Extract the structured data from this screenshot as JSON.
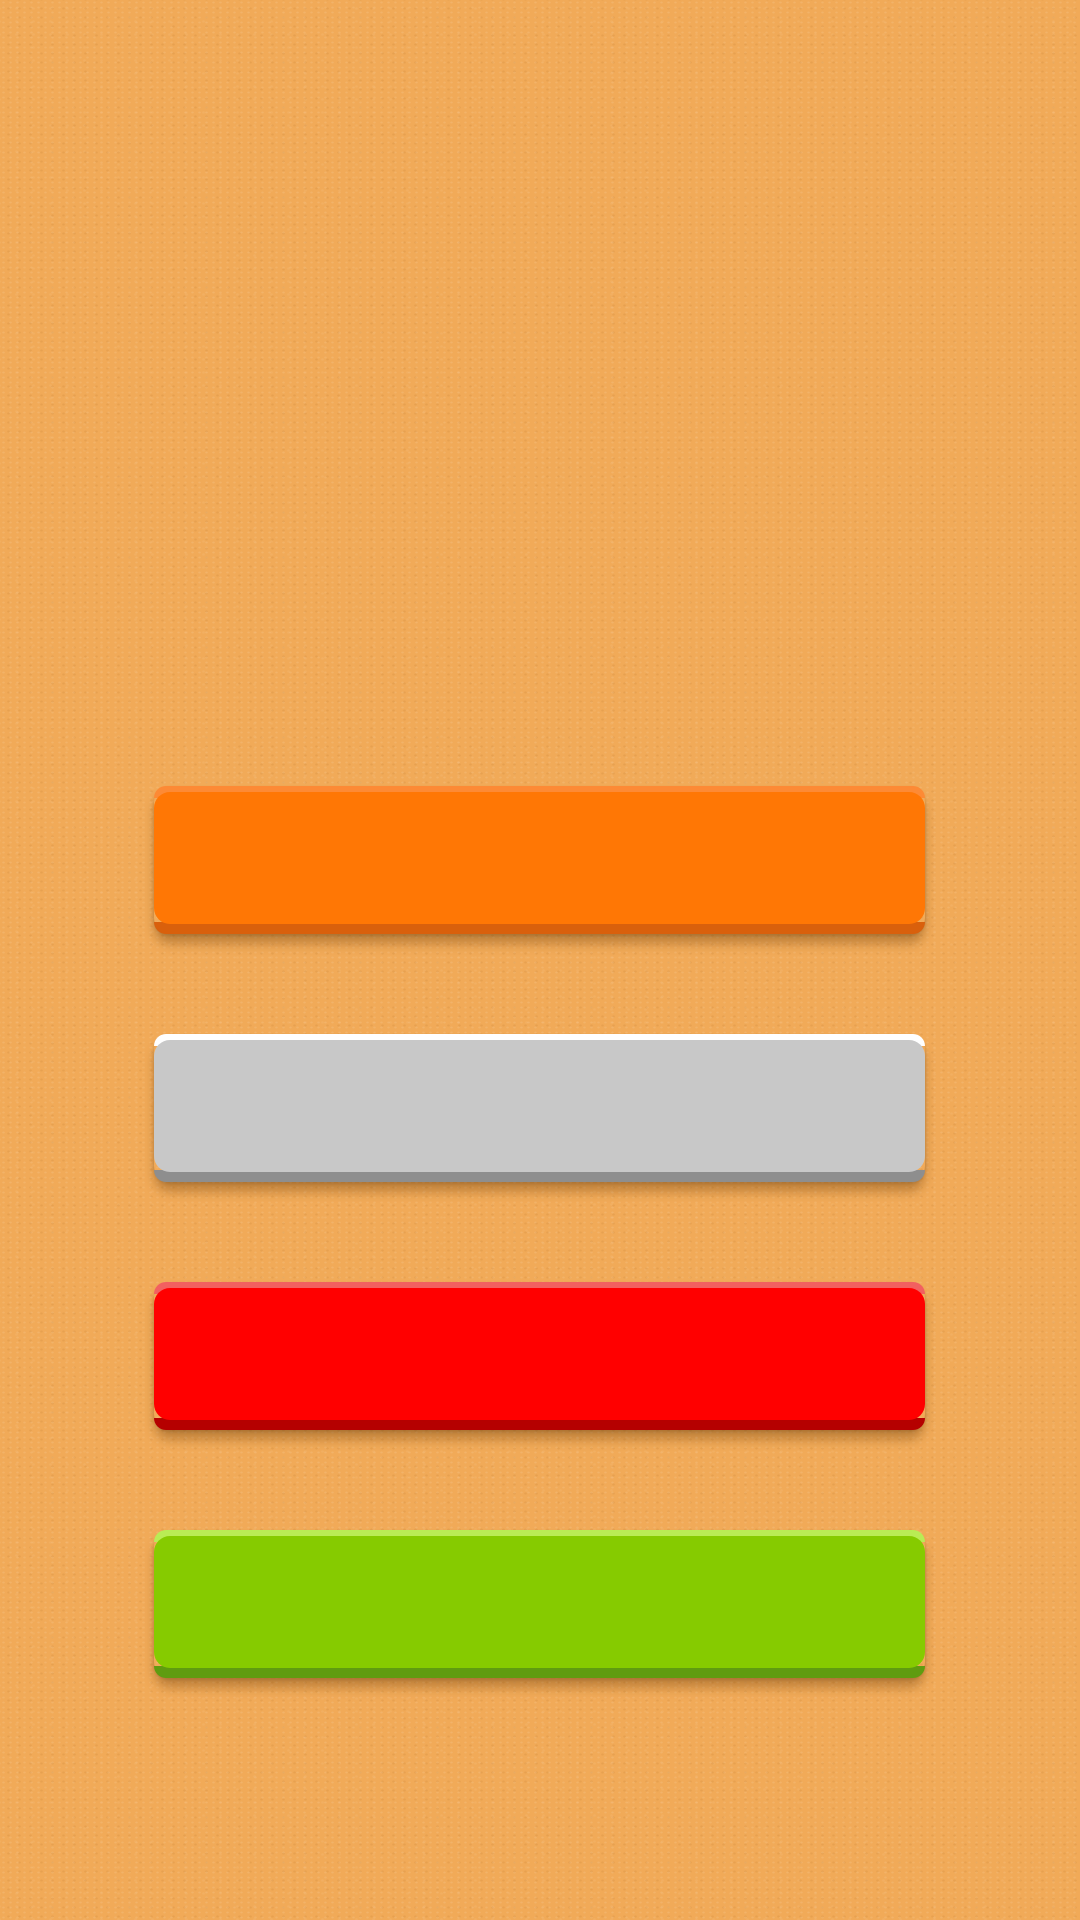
{
  "buttons": [
    {
      "id": "orange",
      "label": "",
      "face": "#ff7705",
      "highlight": "#fd8a35",
      "shade": "#d9600c"
    },
    {
      "id": "gray",
      "label": "",
      "face": "#c8c8c8",
      "highlight": "#ffffff",
      "shade": "#8e8e8e"
    },
    {
      "id": "red",
      "label": "",
      "face": "#ff0000",
      "highlight": "#f26060",
      "shade": "#b50000"
    },
    {
      "id": "green",
      "label": "",
      "face": "#86cb00",
      "highlight": "#b9ec55",
      "shade": "#5f9c10"
    }
  ],
  "background_color": "#f1aa58"
}
